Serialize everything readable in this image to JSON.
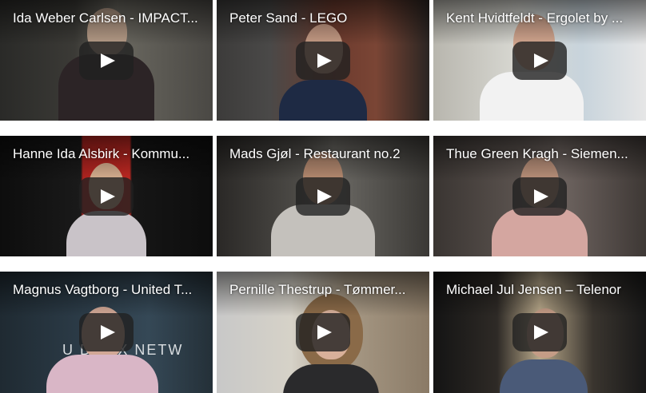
{
  "colors": {
    "play_button_bg": "#212121",
    "play_triangle": "#ffffff",
    "title_text": "#ffffff",
    "page_bg": "#ffffff"
  },
  "play_icon": "play-icon",
  "videos": [
    {
      "title": "Ida Weber Carlsen - IMPACT..."
    },
    {
      "title": "Peter Sand - LEGO"
    },
    {
      "title": "Kent Hvidtfeldt - Ergolet by ..."
    },
    {
      "title": "Hanne Ida Alsbirk - Kommu..."
    },
    {
      "title": "Mads Gjøl - Restaurant no.2"
    },
    {
      "title": "Thue Green Kragh - Siemen..."
    },
    {
      "title": "Magnus Vagtborg - United T...",
      "scene_text": "U   D TAX NETW"
    },
    {
      "title": "Pernille Thestrup - Tømmer..."
    },
    {
      "title": "Michael Jul Jensen – Telenor"
    }
  ]
}
